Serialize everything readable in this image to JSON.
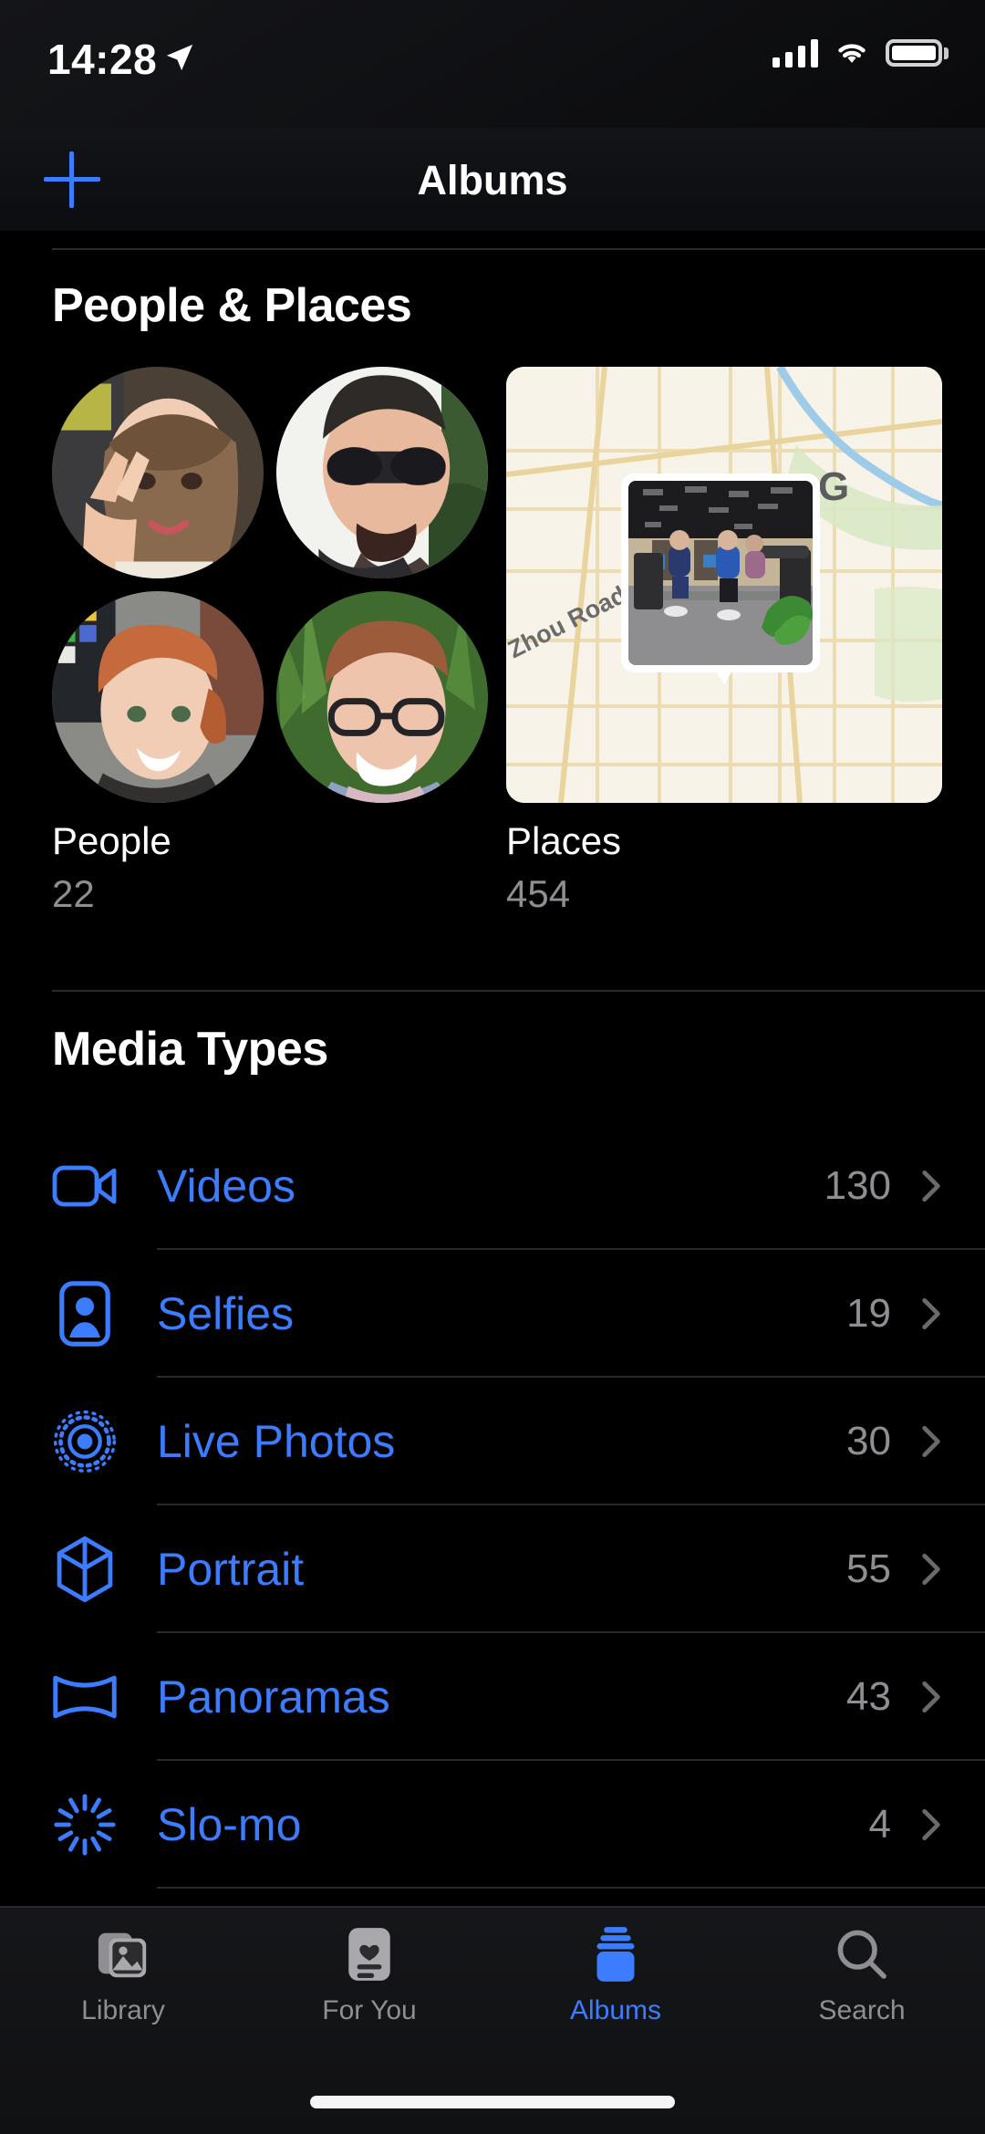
{
  "status_bar": {
    "time": "14:28",
    "location_icon": "location-arrow-icon",
    "signal_icon": "cellular-signal-icon",
    "signal_bars": 4,
    "wifi_icon": "wifi-icon",
    "battery_icon": "battery-full-icon"
  },
  "nav": {
    "title": "Albums",
    "add_icon": "plus-icon"
  },
  "people_places": {
    "section_title": "People & Places",
    "people": {
      "label": "People",
      "count": "22",
      "faces": [
        "face-thumbnail-1",
        "face-thumbnail-2",
        "face-thumbnail-3",
        "face-thumbnail-4"
      ]
    },
    "places": {
      "label": "Places",
      "count": "454",
      "map_labels": [
        "Zhou Road",
        "G"
      ],
      "pin_icon": "photo-pin-thumbnail"
    }
  },
  "media_types": {
    "section_title": "Media Types",
    "rows": [
      {
        "label": "Videos",
        "count": "130",
        "icon": "video-camera-icon"
      },
      {
        "label": "Selfies",
        "count": "19",
        "icon": "selfie-person-icon"
      },
      {
        "label": "Live Photos",
        "count": "30",
        "icon": "live-photo-icon"
      },
      {
        "label": "Portrait",
        "count": "55",
        "icon": "cube-portrait-icon"
      },
      {
        "label": "Panoramas",
        "count": "43",
        "icon": "panorama-icon"
      },
      {
        "label": "Slo-mo",
        "count": "4",
        "icon": "slo-mo-burst-icon"
      }
    ],
    "chevron_icon": "chevron-right-icon"
  },
  "tab_bar": {
    "tabs": [
      {
        "label": "Library",
        "icon": "photos-library-icon",
        "active": false
      },
      {
        "label": "For You",
        "icon": "for-you-card-icon",
        "active": false
      },
      {
        "label": "Albums",
        "icon": "albums-stack-icon",
        "active": true
      },
      {
        "label": "Search",
        "icon": "magnifier-icon",
        "active": false
      }
    ]
  },
  "colors": {
    "accent": "#3c7cff",
    "background": "#000000",
    "secondary_text": "#8e8e93",
    "separator": "#2a2a2c"
  }
}
